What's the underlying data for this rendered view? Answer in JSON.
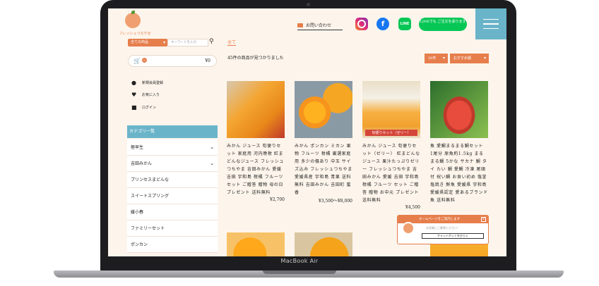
{
  "device": {
    "brand_label": "MacBook Air"
  },
  "header": {
    "logo_text": "フレッシュつちやま",
    "contact_label": "お問い合わせ",
    "line_icon_label": "LINE",
    "line_button": "LINEでも ご注文を承ります"
  },
  "sidebar": {
    "category_select": "全ての商品",
    "keyword_placeholder": "キーワードを入力",
    "cart_count": "0",
    "cart_total": "¥0",
    "account": [
      {
        "icon": "user-icon",
        "label": "新規会員登録"
      },
      {
        "icon": "heart-icon",
        "label": "お気に入り"
      },
      {
        "icon": "lock-icon",
        "label": "ログイン"
      }
    ],
    "category_heading": "カテゴリ一覧",
    "categories": [
      {
        "label": "極早生",
        "expandable": true
      },
      {
        "label": "吉田みかん",
        "expandable": true
      },
      {
        "label": "プリンセスまどんな",
        "expandable": false
      },
      {
        "label": "スイートスプリング",
        "expandable": false
      },
      {
        "label": "媛小春",
        "expandable": false
      },
      {
        "label": "ファミリーセット",
        "expandable": false
      },
      {
        "label": "ポンカン",
        "expandable": false
      }
    ]
  },
  "main": {
    "breadcrumb": "全て",
    "result_count": "45件の商品が見つかりました",
    "per_page": "20件",
    "sort": "おすすめ順",
    "products": [
      {
        "title": "みかん ジュース 旬便りセット 家庭用 河内晩柑 紅まどんなジュース フレッシュつちやま 吉田みかん 愛媛 吉田 宇和島 柑橘 フルーツ セット ご贈答 贈物 母の日 プレゼント 送料無料",
        "price": "¥2,700",
        "tag": ""
      },
      {
        "title": "みかん ポンカン ミカン 果物 フルーツ 柑橘 厳選家庭用 多少の傷あり 中玉 サイズ込み フレッシュつちやま 愛媛県産 宇和島 青果 送料無料 吉田みかん 吉田町 蜜香",
        "price": "¥3,500～¥8,000",
        "tag": ""
      },
      {
        "title": "みかん ジュース 旬便りセット（ゼリー） 紅まどんなジュース 果汁たっぷりゼリー フレッシュつちやま 吉田みかん 愛媛 吉田 宇和島 柑橘 フルーツ セット ご贈答 贈物 お中元 プレゼント 送料無料",
        "price": "¥4,500",
        "tag": "旬便りセット（ゼリー）"
      },
      {
        "title": "魚 愛鯛まるまる鯛セット 1尾分 原魚約1.5kg まるまる鯛 5かな サカナ 鯛 タイ たい 鯛 愛鯛 冷凍 尾頭付 祝い鯛 お食い初め 塩釜 塩焼き 鮮魚 愛媛県 宇和島 愛媛県認定 愛あるブランド魚 送料無料",
        "price": "",
        "tag": ""
      }
    ]
  },
  "chat": {
    "header": "ホームページをご案内します",
    "message": "お気軽にご質問ください！",
    "button": "チャットボットをひらく"
  }
}
